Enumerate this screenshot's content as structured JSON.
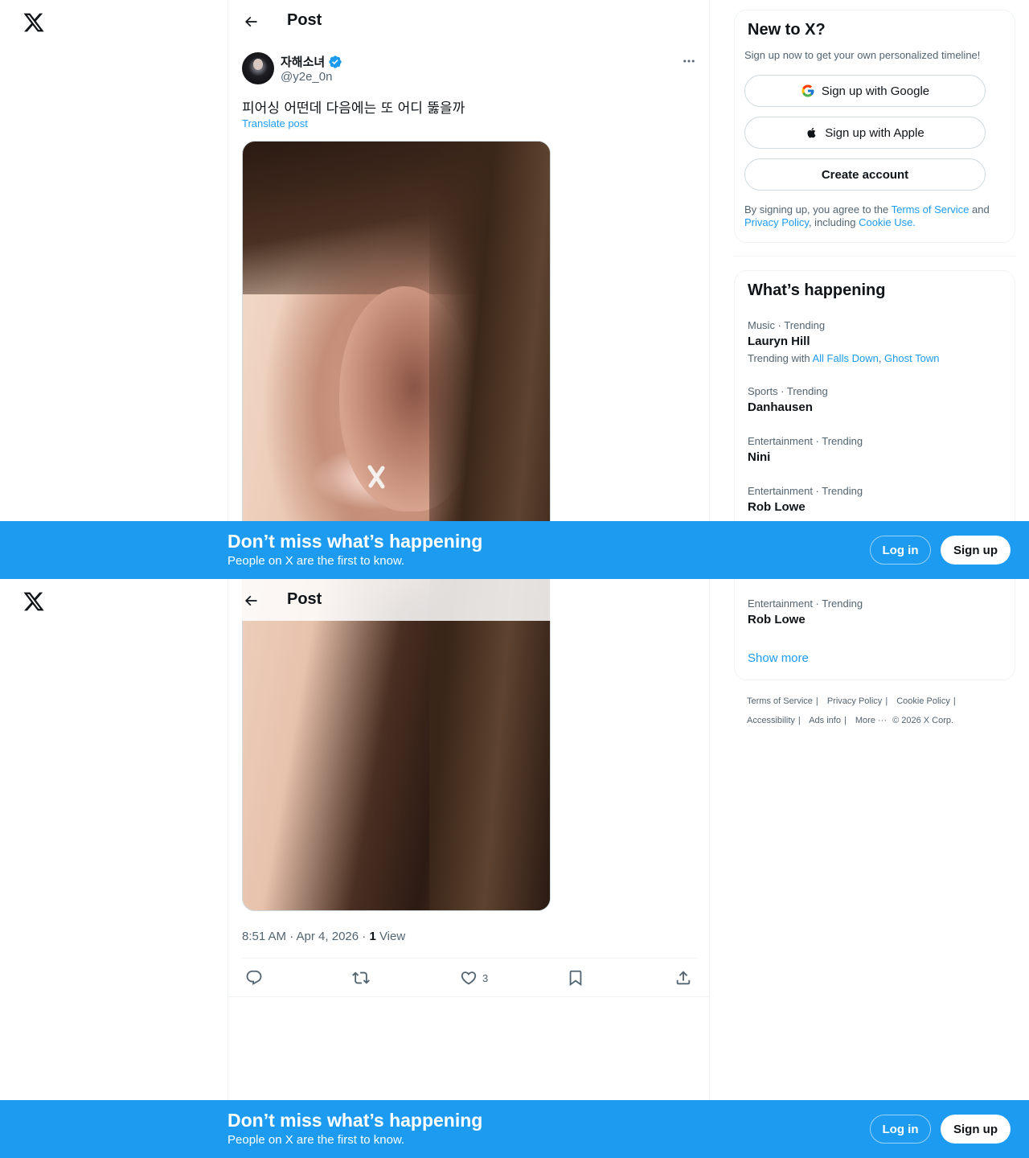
{
  "post": {
    "page_title": "Post",
    "author_name": "자해소녀",
    "author_handle": "@y2e_0n",
    "text": "피어싱 어떤데 다음에는 또 어디 뚫을까",
    "translate_label": "Translate post",
    "time": "8:51 AM · Apr 4, 2026 · ",
    "views_count": "1",
    "views_label": " View",
    "likes": "3"
  },
  "signup": {
    "title": "New to X?",
    "subtitle": "Sign up now to get your own personalized timeline!",
    "google": "Sign up with Google",
    "apple": "Sign up with Apple",
    "create": "Create account",
    "legal_1": "By signing up, you agree to the ",
    "terms": "Terms of Service",
    "legal_2": " and ",
    "privacy": "Privacy Policy",
    "legal_3": ", including ",
    "cookie": "Cookie Use."
  },
  "trends": {
    "title": "What’s happening",
    "items": [
      {
        "meta": "Music · Trending",
        "name": "Lauryn Hill",
        "with_label": "Trending with ",
        "with_1": "All Falls Down",
        "with_sep": ", ",
        "with_2": "Ghost Town"
      },
      {
        "meta": "Sports · Trending",
        "name": "Danhausen"
      },
      {
        "meta": "Entertainment · Trending",
        "name": "Nini"
      },
      {
        "meta": "Entertainment · Trending",
        "name": "Rob Lowe"
      }
    ],
    "show_more": "Show more"
  },
  "footer": {
    "links": [
      "Terms of Service",
      "Privacy Policy",
      "Cookie Policy",
      "Accessibility",
      "Ads info",
      "More ···",
      "© 2026 X Corp."
    ]
  },
  "banner": {
    "title": "Don’t miss what’s happening",
    "subtitle": "People on X are the first to know.",
    "login": "Log in",
    "signup": "Sign up"
  },
  "colors": {
    "accent": "#1d9bf0",
    "text": "#0f1419",
    "muted": "#536471"
  },
  "icons": [
    "x-logo-icon",
    "back-arrow-icon",
    "verified-badge-icon",
    "more-icon",
    "reply-icon",
    "repost-icon",
    "like-icon",
    "bookmark-icon",
    "share-icon",
    "google-icon",
    "apple-icon"
  ]
}
